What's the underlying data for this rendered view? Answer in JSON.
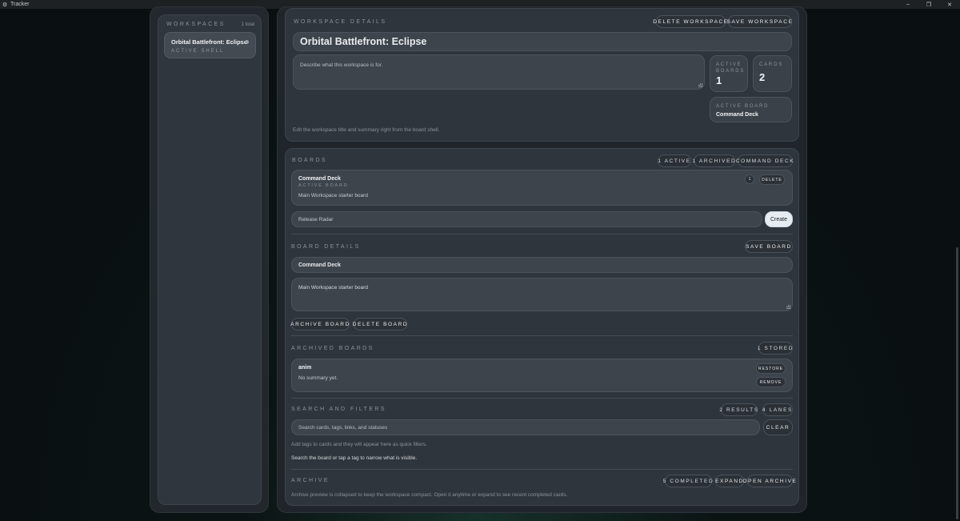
{
  "window": {
    "title": "Tracker",
    "app_icon": "gear-icon",
    "minimize": "–",
    "restore": "❐",
    "close": "✕"
  },
  "sidebar": {
    "heading": "Workspaces",
    "count": "1 total",
    "items": [
      {
        "name": "Orbital Battlefront: Eclipse",
        "status": "Active shell"
      }
    ]
  },
  "workspace_details": {
    "heading": "Workspace details",
    "delete_label": "Delete workspace",
    "save_label": "Save workspace",
    "title_value": "Orbital Battlefront: Eclipse",
    "summary_placeholder": "Describe what this workspace is for.",
    "stats": {
      "active_boards_label": "Active boards",
      "active_boards_value": "1",
      "cards_label": "Cards",
      "cards_value": "2",
      "active_board_label": "Active board",
      "active_board_value": "Command Deck"
    },
    "hint": "Edit the workspace title and summary right from the board shell."
  },
  "boards": {
    "heading": "Boards",
    "badges": {
      "active": "1 active",
      "archived": "1 archived",
      "current": "Command Deck"
    },
    "list": [
      {
        "name": "Command Deck",
        "tag": "Active board",
        "summary": "Main Workspace starter board",
        "count": "1",
        "delete_label": "Delete"
      }
    ],
    "new_board_value": "Release Radar",
    "create_label": "Create"
  },
  "board_details": {
    "heading": "Board details",
    "save_label": "Save board",
    "name_value": "Command Deck",
    "summary_value": "Main Workspace starter board",
    "archive_label": "Archive board",
    "delete_label": "Delete board"
  },
  "archived_boards": {
    "heading": "Archived boards",
    "stored_badge": "1 stored",
    "items": [
      {
        "name": "anim",
        "summary": "No summary yet.",
        "restore_label": "Restore",
        "remove_label": "Remove"
      }
    ]
  },
  "search": {
    "heading": "Search and filters",
    "results_badge": "2 results",
    "lanes_badge": "4 lanes",
    "placeholder": "Search cards, tags, links, and statuses",
    "clear_label": "Clear",
    "tags_hint": "Add tags to cards and they will appear here as quick filters.",
    "help": "Search the board or tap a tag to narrow what is visible."
  },
  "archive": {
    "heading": "Archive",
    "completed_badge": "5 completed",
    "expand_label": "Expand",
    "open_label": "Open archive",
    "note": "Archive preview is collapsed to keep the workspace compact. Open it anytime or expand to see recent completed cards."
  }
}
